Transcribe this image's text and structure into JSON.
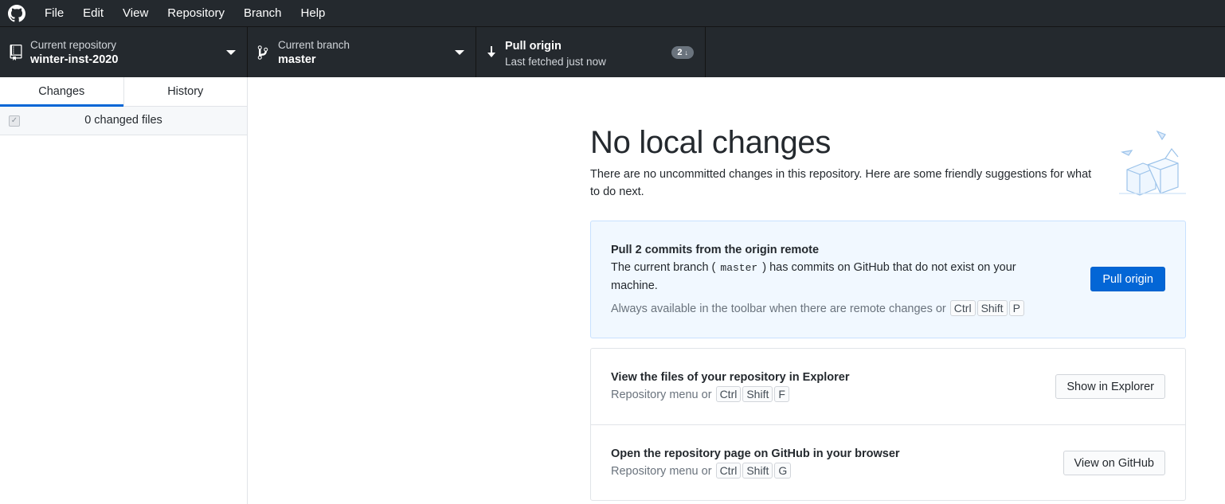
{
  "menu": {
    "items": [
      "File",
      "Edit",
      "View",
      "Repository",
      "Branch",
      "Help"
    ]
  },
  "toolbar": {
    "repository": {
      "label": "Current repository",
      "value": "winter-inst-2020"
    },
    "branch": {
      "label": "Current branch",
      "value": "master"
    },
    "pull": {
      "title": "Pull origin",
      "subtitle": "Last fetched just now",
      "badge": "2"
    }
  },
  "sidebar": {
    "tabs": [
      {
        "label": "Changes",
        "active": true
      },
      {
        "label": "History",
        "active": false
      }
    ],
    "changed_files": "0 changed files"
  },
  "main": {
    "headline": "No local changes",
    "intro": "There are no uncommitted changes in this repository. Here are some friendly suggestions for what to do next.",
    "pull_card": {
      "title": "Pull 2 commits from the origin remote",
      "body_before": "The current branch (",
      "branch": "master",
      "body_after": ") has commits on GitHub that do not exist on your machine.",
      "hint": "Always available in the toolbar when there are remote changes or",
      "keys": [
        "Ctrl",
        "Shift",
        "P"
      ],
      "button": "Pull origin"
    },
    "explorer_card": {
      "title": "View the files of your repository in Explorer",
      "hint": "Repository menu or",
      "keys": [
        "Ctrl",
        "Shift",
        "F"
      ],
      "button": "Show in Explorer"
    },
    "github_card": {
      "title": "Open the repository page on GitHub in your browser",
      "hint": "Repository menu or",
      "keys": [
        "Ctrl",
        "Shift",
        "G"
      ],
      "button": "View on GitHub"
    }
  },
  "colors": {
    "toolbar_bg": "#24292e",
    "accent": "#0366d6",
    "pull_card_bg": "#f1f8ff"
  },
  "icons": [
    "github-logo-icon",
    "repo-icon",
    "branch-icon",
    "arrow-down-icon",
    "checkbox-icon",
    "paper-boxes-illustration"
  ]
}
